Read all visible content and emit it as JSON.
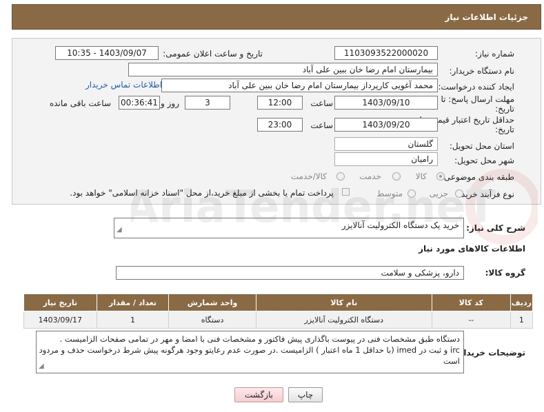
{
  "header": {
    "title": "جزئیات اطلاعات نیاز"
  },
  "form": {
    "need_number": {
      "label": "شماره نیاز:",
      "value": "1103093522000020"
    },
    "announce_datetime": {
      "label": "تاریخ و ساعت اعلان عمومی:",
      "value": "1403/09/07 - 10:35"
    },
    "buyer_org": {
      "label": "نام دستگاه خریدار:",
      "value": "بیمارستان امام رضا خان ببین علی آباد"
    },
    "requester": {
      "label": "ایجاد کننده درخواست:",
      "value": "محمد  آغویی کارپرداز بیمارستان امام رضا خان ببین علی آباد",
      "contact_link": "اطلاعات تماس خریدار"
    },
    "deadline": {
      "label_line1": "مهلت ارسال پاسخ: تا",
      "label_line2": "تاریخ:",
      "date": "1403/09/10",
      "time_label": "ساعت",
      "time": "12:00",
      "days": "3",
      "days_label": "روز و",
      "remaining": "00:36:41",
      "remaining_label": "ساعت باقی مانده"
    },
    "price_validity": {
      "label_line1": "حداقل تاریخ اعتبار قیمت: تا",
      "label_line2": "تاریخ:",
      "date": "1403/09/20",
      "time_label": "ساعت",
      "time": "23:00"
    },
    "province": {
      "label": "استان محل تحویل:",
      "value": "گلستان"
    },
    "city": {
      "label": "شهر محل تحویل:",
      "value": "رامیان"
    },
    "category": {
      "label": "طبقه بندی موضوعی:",
      "options": [
        "کالا",
        "خدمت",
        "کالا/خدمت"
      ],
      "selected": "کالا"
    },
    "purchase_type": {
      "label": "نوع فرآیند خرید :",
      "options": [
        "جزیی",
        "متوسط"
      ],
      "payment_note": "پرداخت تمام یا بخشی از مبلغ خرید،از محل \"اسناد خزانه اسلامی\" خواهد بود."
    }
  },
  "summary": {
    "label": "شرح کلی نیاز:",
    "value": "خرید یک دستگاه الکترولیت آنالایزر"
  },
  "goods_info": {
    "title": "اطلاعات کالاهای مورد نیاز",
    "group_label": "گروه کالا:",
    "group_value": "دارو، پزشکی و سلامت"
  },
  "table": {
    "headers": [
      "ردیف",
      "کد کالا",
      "نام کالا",
      "واحد شمارش",
      "تعداد / مقدار",
      "تاریخ نیاز"
    ],
    "rows": [
      [
        "1",
        "--",
        "دستگاه الکترولیت آنالایزر",
        "دستگاه",
        "1",
        "1403/09/17"
      ]
    ]
  },
  "buyer_notes": {
    "label": "توضیحات خریدار:",
    "lines": [
      "دستگاه طبق  مشخصات فنی در پیوست باگذاری پیش فاکتور  و مشخصات فنی با امضا و مهر در تمامی صفحات الزامیست .",
      "irc  و ثبت در imed (با حداقل 1 ماه اعتبار ) الزامیست .در صورت عدم رعایتو وجود هرگونه پیش شرط  درخواست حذف و مردود",
      "است"
    ]
  },
  "buttons": {
    "print": "چاپ",
    "back": "بازگشت"
  },
  "watermark": {
    "text": "AriaTender.neT"
  },
  "colors": {
    "header_bg": "#8a6a45",
    "link": "#1a5fb4"
  }
}
